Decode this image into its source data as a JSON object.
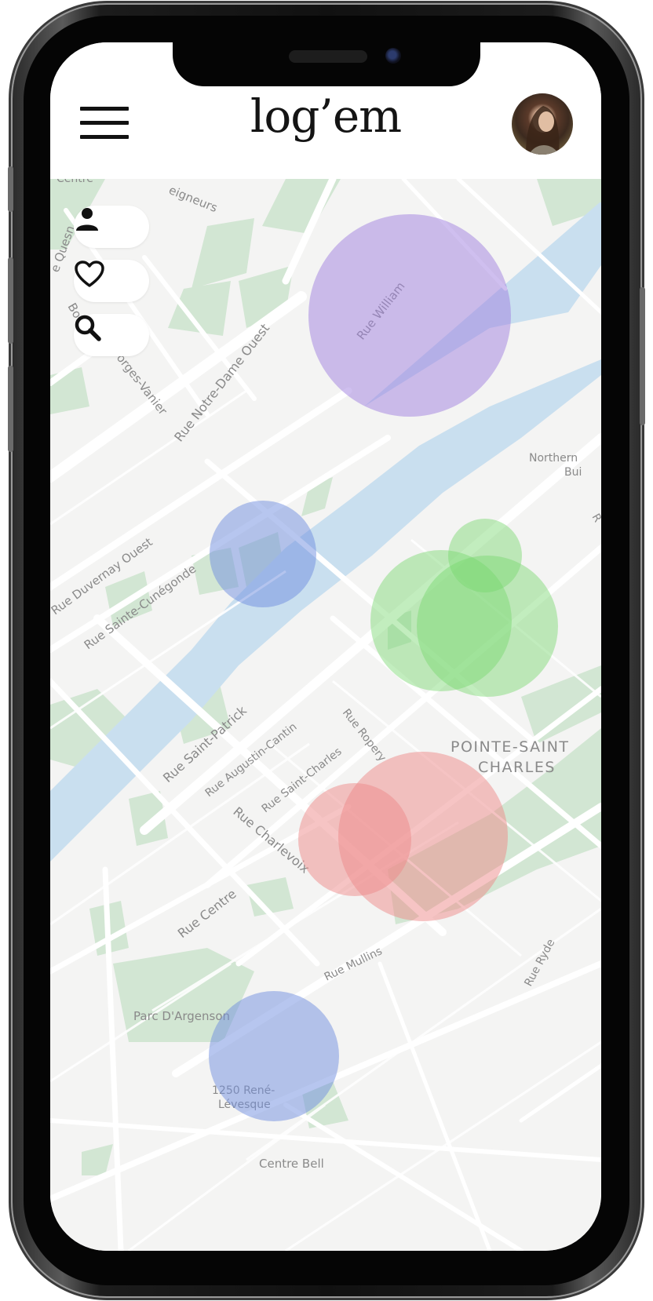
{
  "app": {
    "logo": "log’em"
  },
  "header": {
    "menu_icon": "hamburger-menu-icon",
    "avatar_icon": "user-avatar"
  },
  "toolbar": {
    "profile_icon": "person-icon",
    "favorites_icon": "heart-icon",
    "search_icon": "search-icon"
  },
  "map": {
    "streets": {
      "rue_william": "Rue William",
      "rue_notre_dame": "Rue Notre-Dame Ouest",
      "bd_georges_vanier": "orges-Vanier",
      "bou": "Bou",
      "quesnel": "e Quesn",
      "seigneurs": "eigneurs",
      "centre_top": "Centre",
      "rue_duvernay": "Rue Duvernay Ouest",
      "rue_sainte_cunegonde": "Rue Sainte-Cunégonde",
      "rue_saint_patrick": "Rue Saint-Patrick",
      "rue_augustin_cantin": "Rue Augustin-Cantin",
      "rue_saint_charles": "Rue Saint-Charles",
      "rue_ropery": "Rue Ropery",
      "rue_charlevoix": "Rue Charlevoix",
      "rue_centre": "Rue Centre",
      "rue_mullins": "Rue Mullins",
      "rue_ryde": "Rue Ryde",
      "northern_1": "Northern",
      "northern_2": "Bui",
      "r_edge": "R",
      "pointe_1": "POINTE-SAINT",
      "pointe_2": "CHARLES",
      "parc": "Parc D'Argenson",
      "rene_1": "1250 René-",
      "rene_2": "Lévesque",
      "centre_bell": "Centre Bell"
    },
    "zone_colors": {
      "purple": "#a07fe0",
      "blue": "#6f8ee0",
      "green": "#78d66e",
      "red": "#ee8a8a"
    }
  }
}
